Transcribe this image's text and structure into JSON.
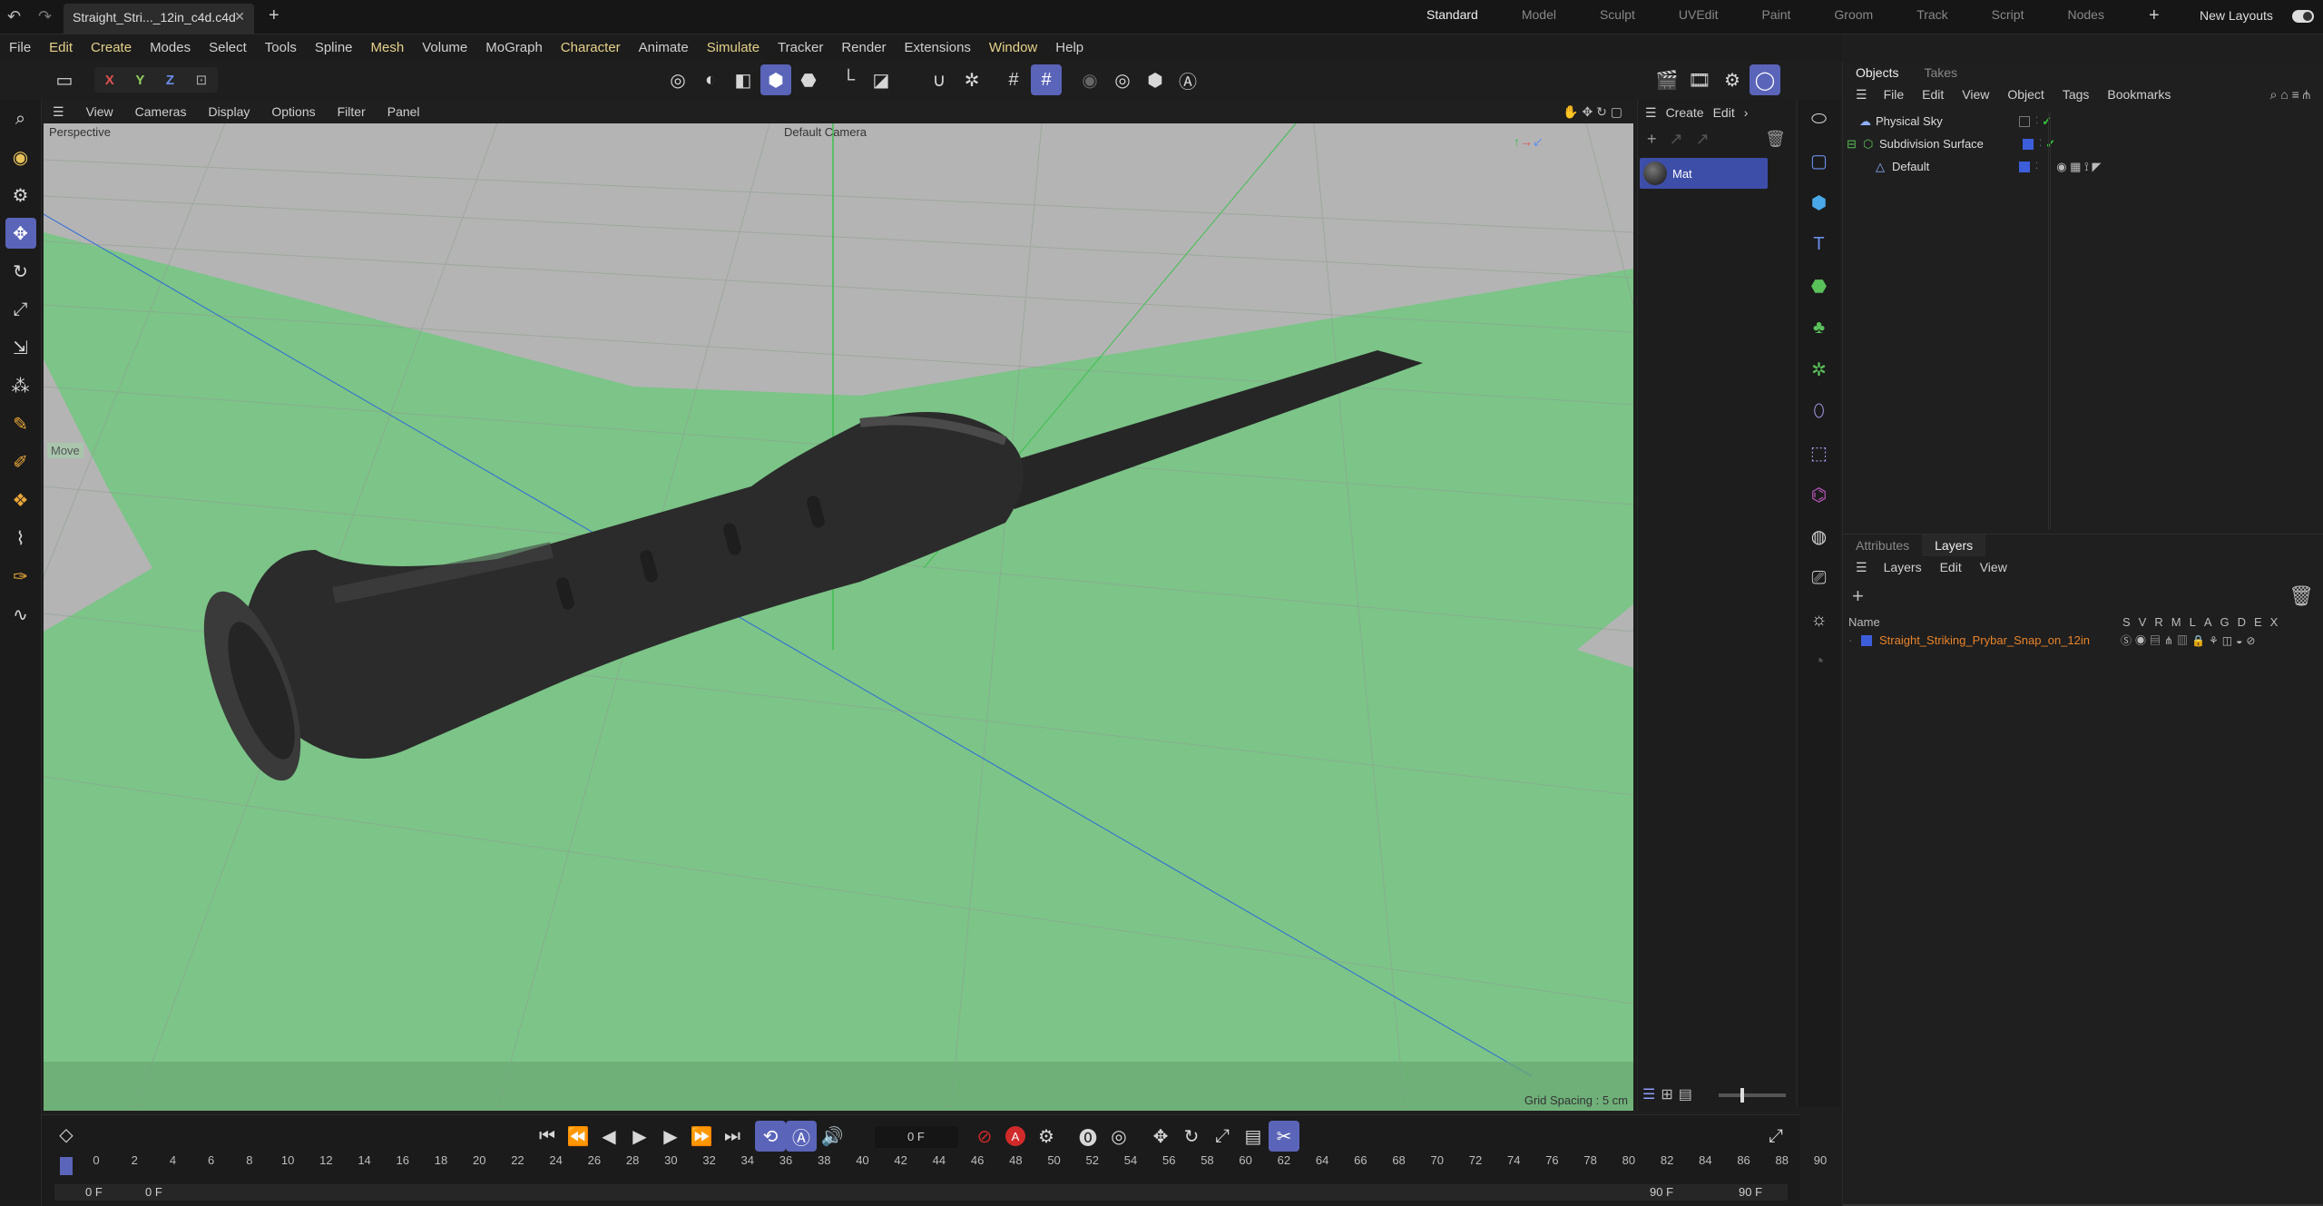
{
  "window": {
    "tab_title": "Straight_Stri..._12in_c4d.c4d",
    "layouts": [
      "Standard",
      "Model",
      "Sculpt",
      "UVEdit",
      "Paint",
      "Groom",
      "Track",
      "Script",
      "Nodes"
    ],
    "active_layout": "Standard",
    "new_layouts_label": "New Layouts"
  },
  "menu": [
    "File",
    "Edit",
    "Create",
    "Modes",
    "Select",
    "Tools",
    "Spline",
    "Mesh",
    "Volume",
    "MoGraph",
    "Character",
    "Animate",
    "Simulate",
    "Tracker",
    "Render",
    "Extensions",
    "Window",
    "Help"
  ],
  "axis_buttons": [
    "X",
    "Y",
    "Z"
  ],
  "viewport": {
    "menu": [
      "View",
      "Cameras",
      "Display",
      "Options",
      "Filter",
      "Panel"
    ],
    "view_label": "Perspective",
    "camera_label": "Default Camera",
    "tool_label": "Move",
    "grid_spacing": "Grid Spacing : 5 cm",
    "background_color": "#7cc488"
  },
  "material_panel": {
    "menu": [
      "Create",
      "Edit"
    ],
    "material_name": "Mat"
  },
  "objects_panel": {
    "tabs": [
      "Objects",
      "Takes"
    ],
    "menu": [
      "File",
      "Edit",
      "View",
      "Object",
      "Tags",
      "Bookmarks"
    ],
    "items": [
      {
        "name": "Physical Sky"
      },
      {
        "name": "Subdivision Surface"
      },
      {
        "name": "Default"
      }
    ]
  },
  "layers_panel": {
    "tabs": [
      "Attributes",
      "Layers"
    ],
    "menu": [
      "Layers",
      "Edit",
      "View"
    ],
    "name_header": "Name",
    "flag_headers": [
      "S",
      "V",
      "R",
      "M",
      "L",
      "A",
      "G",
      "D",
      "E",
      "X"
    ],
    "layer_name": "Straight_Striking_Prybar_Snap_on_12in",
    "layer_color": "#e8832a"
  },
  "timeline": {
    "current_frame": "0 F",
    "ticks": [
      "0",
      "2",
      "4",
      "6",
      "8",
      "10",
      "12",
      "14",
      "16",
      "18",
      "20",
      "22",
      "24",
      "26",
      "28",
      "30",
      "32",
      "34",
      "36",
      "38",
      "40",
      "42",
      "44",
      "46",
      "48",
      "50",
      "52",
      "54",
      "56",
      "58",
      "60",
      "62",
      "64",
      "66",
      "68",
      "70",
      "72",
      "74",
      "76",
      "78",
      "80",
      "82",
      "84",
      "86",
      "88",
      "90"
    ],
    "start_left": "0 F",
    "start_right": "0 F",
    "end_left": "90 F",
    "end_right": "90 F"
  },
  "colors": {
    "accent": "#5a64b8",
    "selection_blue": "#3d5edb",
    "check_green": "#34c83b",
    "key_red": "#d02a2a"
  }
}
